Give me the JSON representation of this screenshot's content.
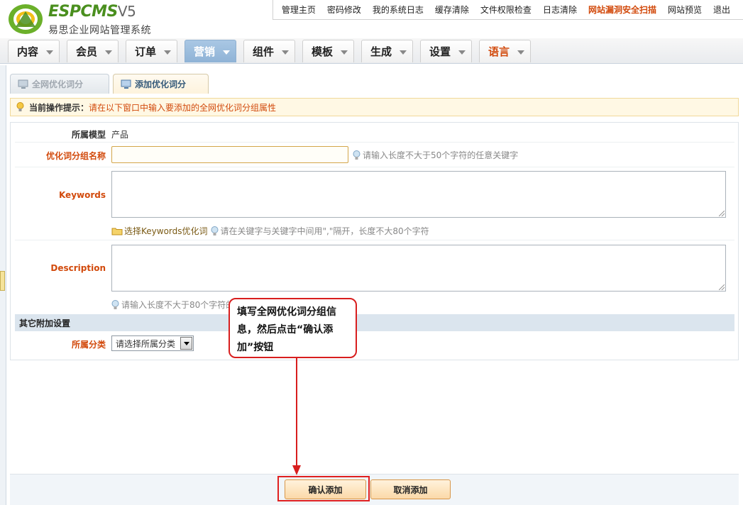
{
  "app": {
    "logo_title": "ESPCMS",
    "logo_version": "V5",
    "logo_subtitle": "易思企业网站管理系统"
  },
  "topnav": [
    {
      "label": "管理主页"
    },
    {
      "label": "密码修改"
    },
    {
      "label": "我的系统日志"
    },
    {
      "label": "缓存清除"
    },
    {
      "label": "文件权限检查"
    },
    {
      "label": "日志清除"
    },
    {
      "label": "网站漏洞安全扫描",
      "highlight": true
    },
    {
      "label": "网站预览"
    },
    {
      "label": "退出"
    }
  ],
  "menu": [
    {
      "label": "内容"
    },
    {
      "label": "会员"
    },
    {
      "label": "订单"
    },
    {
      "label": "营销",
      "active": true
    },
    {
      "label": "组件"
    },
    {
      "label": "模板"
    },
    {
      "label": "生成"
    },
    {
      "label": "设置"
    },
    {
      "label": "语言",
      "red": true
    }
  ],
  "tabs": [
    {
      "label": "全网优化词分",
      "active": false
    },
    {
      "label": "添加优化词分",
      "active": true
    }
  ],
  "hint": {
    "label": "当前操作提示：",
    "message": "请在以下窗口中输入要添加的全网优化词分组属性"
  },
  "form": {
    "model_label": "所属模型",
    "model_value": "产品",
    "group_label": "优化词分组名称",
    "group_value": "",
    "group_tip": "请输入长度不大于50个字符的任意关键字",
    "keywords_label": "Keywords",
    "keywords_value": "",
    "keywords_pick": "选择Keywords优化词",
    "keywords_tip": "请在关键字与关键字中间用\",\"隔开，长度不大80个字符",
    "description_label": "Description",
    "description_value": "",
    "description_tip": "请输入长度不大于80个字符的",
    "section_title": "其它附加设置",
    "category_label": "所属分类",
    "category_selected": "请选择所属分类"
  },
  "buttons": {
    "confirm": "确认添加",
    "cancel": "取消添加"
  },
  "callout": {
    "text": "填写全网优化词分组信息，然后点击“确认添加”按钮"
  },
  "colors": {
    "accent_red": "#d24a0c",
    "active_menu": "#9dbde0",
    "annotation_red": "#d81e1e"
  }
}
